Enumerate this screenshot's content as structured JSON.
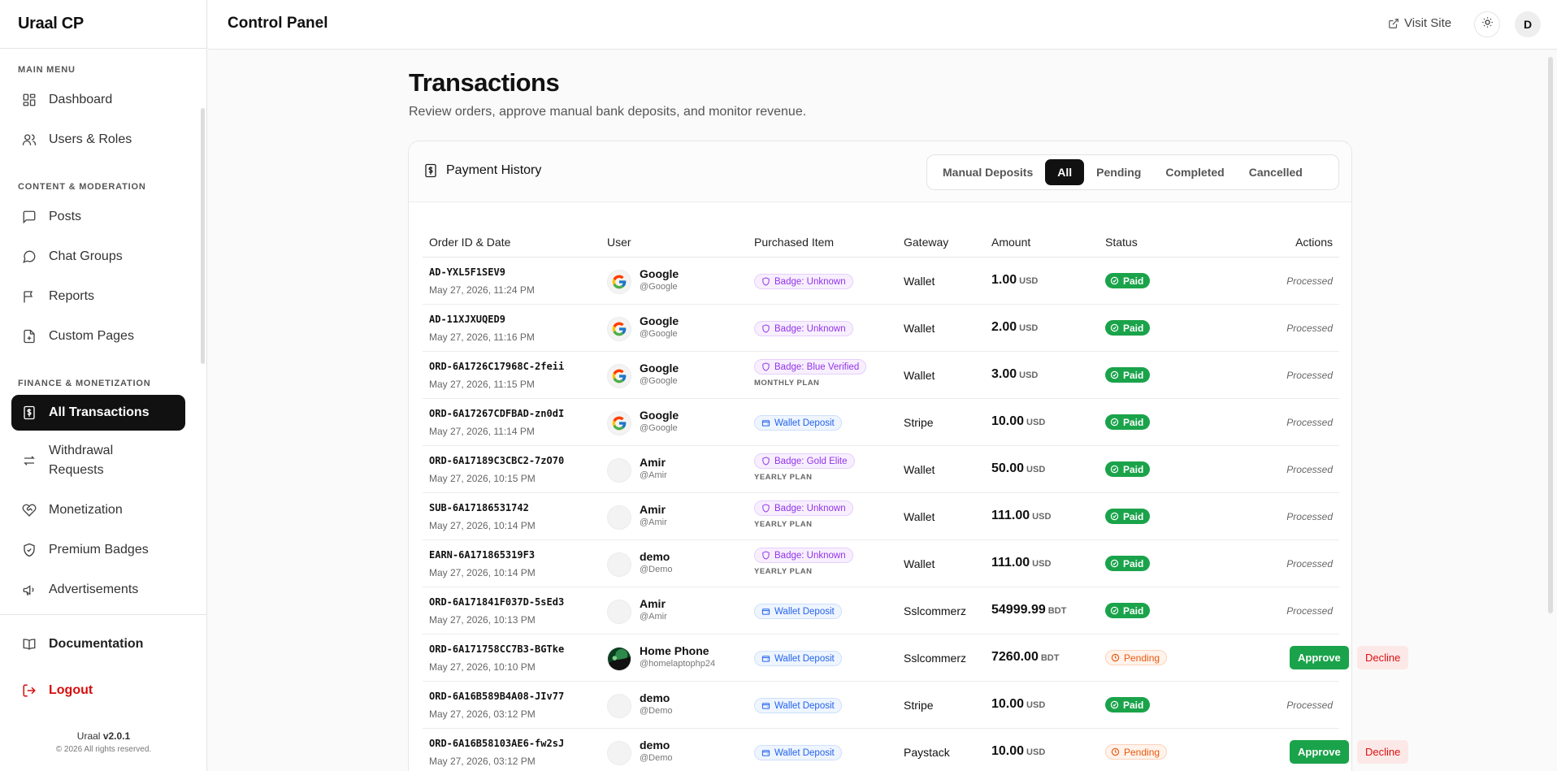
{
  "brand": "Uraal CP",
  "header": {
    "title": "Control Panel",
    "visit_site": "Visit Site",
    "avatar_initial": "D"
  },
  "sidebar": {
    "sections": [
      "MAIN MENU",
      "CONTENT & MODERATION",
      "FINANCE & MONETIZATION"
    ],
    "items": [
      {
        "label": "Dashboard",
        "icon": "dashboard-icon"
      },
      {
        "label": "Users & Roles",
        "icon": "users-icon"
      },
      {
        "label": "Posts",
        "icon": "message-square-icon"
      },
      {
        "label": "Chat Groups",
        "icon": "chat-bubble-icon"
      },
      {
        "label": "Reports",
        "icon": "flag-icon"
      },
      {
        "label": "Custom Pages",
        "icon": "file-plus-icon"
      },
      {
        "label": "All Transactions",
        "icon": "dollar-receipt-icon",
        "active": true
      },
      {
        "label": "Withdrawal Requests",
        "icon": "arrows-exchange-icon"
      },
      {
        "label": "Monetization",
        "icon": "heart-handshake-icon"
      },
      {
        "label": "Premium Badges",
        "icon": "shield-check-icon"
      },
      {
        "label": "Advertisements",
        "icon": "megaphone-icon"
      }
    ],
    "documentation": "Documentation",
    "logout": "Logout",
    "version_prefix": "Uraal ",
    "version": "v2.0.1",
    "copyright": "© 2026 All rights reserved."
  },
  "page": {
    "title": "Transactions",
    "subtitle": "Review orders, approve manual bank deposits, and monitor revenue."
  },
  "card": {
    "title": "Payment History",
    "tabs": [
      "Manual Deposits",
      "All",
      "Pending",
      "Completed",
      "Cancelled"
    ],
    "active_tab": "All"
  },
  "table": {
    "headers": [
      "Order ID & Date",
      "User",
      "Purchased Item",
      "Gateway",
      "Amount",
      "Status",
      "Actions"
    ],
    "rows": [
      {
        "id": "AD-YXL5F1SEV9",
        "date": "May 27, 2026, 11:24 PM",
        "user": "Google",
        "handle": "@Google",
        "avatar": "google",
        "item": "Badge: Unknown",
        "item_type": "badge",
        "plan": "",
        "gateway": "Wallet",
        "amount": "1.00",
        "currency": "USD",
        "status": "Paid",
        "action": "Processed"
      },
      {
        "id": "AD-11XJXUQED9",
        "date": "May 27, 2026, 11:16 PM",
        "user": "Google",
        "handle": "@Google",
        "avatar": "google",
        "item": "Badge: Unknown",
        "item_type": "badge",
        "plan": "",
        "gateway": "Wallet",
        "amount": "2.00",
        "currency": "USD",
        "status": "Paid",
        "action": "Processed"
      },
      {
        "id": "ORD-6A1726C17968C-2feii",
        "date": "May 27, 2026, 11:15 PM",
        "user": "Google",
        "handle": "@Google",
        "avatar": "google",
        "item": "Badge: Blue Verified",
        "item_type": "badge",
        "plan": "MONTHLY PLAN",
        "gateway": "Wallet",
        "amount": "3.00",
        "currency": "USD",
        "status": "Paid",
        "action": "Processed"
      },
      {
        "id": "ORD-6A17267CDFBAD-zn0dI",
        "date": "May 27, 2026, 11:14 PM",
        "user": "Google",
        "handle": "@Google",
        "avatar": "google",
        "item": "Wallet Deposit",
        "item_type": "wallet",
        "plan": "",
        "gateway": "Stripe",
        "amount": "10.00",
        "currency": "USD",
        "status": "Paid",
        "action": "Processed"
      },
      {
        "id": "ORD-6A17189C3CBC2-7zO70",
        "date": "May 27, 2026, 10:15 PM",
        "user": "Amir",
        "handle": "@Amir",
        "avatar": "blank",
        "item": "Badge: Gold Elite",
        "item_type": "badge",
        "plan": "YEARLY PLAN",
        "gateway": "Wallet",
        "amount": "50.00",
        "currency": "USD",
        "status": "Paid",
        "action": "Processed"
      },
      {
        "id": "SUB-6A17186531742",
        "date": "May 27, 2026, 10:14 PM",
        "user": "Amir",
        "handle": "@Amir",
        "avatar": "blank",
        "item": "Badge: Unknown",
        "item_type": "badge",
        "plan": "YEARLY PLAN",
        "gateway": "Wallet",
        "amount": "111.00",
        "currency": "USD",
        "status": "Paid",
        "action": "Processed"
      },
      {
        "id": "EARN-6A171865319F3",
        "date": "May 27, 2026, 10:14 PM",
        "user": "demo",
        "handle": "@Demo",
        "avatar": "blank",
        "item": "Badge: Unknown",
        "item_type": "badge",
        "plan": "YEARLY PLAN",
        "gateway": "Wallet",
        "amount": "111.00",
        "currency": "USD",
        "status": "Paid",
        "action": "Processed"
      },
      {
        "id": "ORD-6A171841F037D-5sEd3",
        "date": "May 27, 2026, 10:13 PM",
        "user": "Amir",
        "handle": "@Amir",
        "avatar": "blank",
        "item": "Wallet Deposit",
        "item_type": "wallet",
        "plan": "",
        "gateway": "Sslcommerz",
        "amount": "54999.99",
        "currency": "BDT",
        "status": "Paid",
        "action": "Processed"
      },
      {
        "id": "ORD-6A171758CC7B3-BGTke",
        "date": "May 27, 2026, 10:10 PM",
        "user": "Home Phone",
        "handle": "@homelaptophp24",
        "avatar": "photo",
        "item": "Wallet Deposit",
        "item_type": "wallet",
        "plan": "",
        "gateway": "Sslcommerz",
        "amount": "7260.00",
        "currency": "BDT",
        "status": "Pending",
        "action": "buttons"
      },
      {
        "id": "ORD-6A16B589B4A08-JIv77",
        "date": "May 27, 2026, 03:12 PM",
        "user": "demo",
        "handle": "@Demo",
        "avatar": "blank",
        "item": "Wallet Deposit",
        "item_type": "wallet",
        "plan": "",
        "gateway": "Stripe",
        "amount": "10.00",
        "currency": "USD",
        "status": "Paid",
        "action": "Processed"
      },
      {
        "id": "ORD-6A16B58103AE6-fw2sJ",
        "date": "May 27, 2026, 03:12 PM",
        "user": "demo",
        "handle": "@Demo",
        "avatar": "blank",
        "item": "Wallet Deposit",
        "item_type": "wallet",
        "plan": "",
        "gateway": "Paystack",
        "amount": "10.00",
        "currency": "USD",
        "status": "Pending",
        "action": "buttons"
      }
    ],
    "approve_label": "Approve",
    "decline_label": "Decline"
  },
  "colors": {
    "paid": "#1aa34a",
    "pending": "#ea580c",
    "badge": "#9333ea",
    "wallet": "#2563eb",
    "logout": "#d60d0d"
  }
}
